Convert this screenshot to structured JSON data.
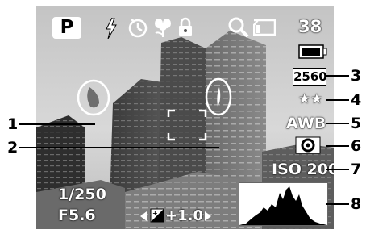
{
  "display": {
    "mode": "P",
    "shots_remaining": "38",
    "resolution": "2560",
    "quality": "★★",
    "white_balance": "AWB",
    "iso": "ISO 200",
    "shutter_speed": "1/250",
    "aperture": "F5.6",
    "exposure_compensation": "+1.0"
  },
  "callouts": [
    "1",
    "2",
    "3",
    "4",
    "5",
    "6",
    "7",
    "8"
  ],
  "icons": {
    "flash": "flash-icon",
    "self_timer": "self-timer-icon",
    "macro": "macro-flower-icon",
    "focus_lock": "lock-icon",
    "digital_zoom": "magnifier-icon",
    "memory_card": "memory-card-icon",
    "battery": "battery-icon",
    "metering": "metering-icon",
    "ev": "ev-compensation-icon"
  },
  "colors": {
    "overlay_text": "#ffffff",
    "callout": "#000000",
    "highlight_warning": "#6e6e6e"
  }
}
